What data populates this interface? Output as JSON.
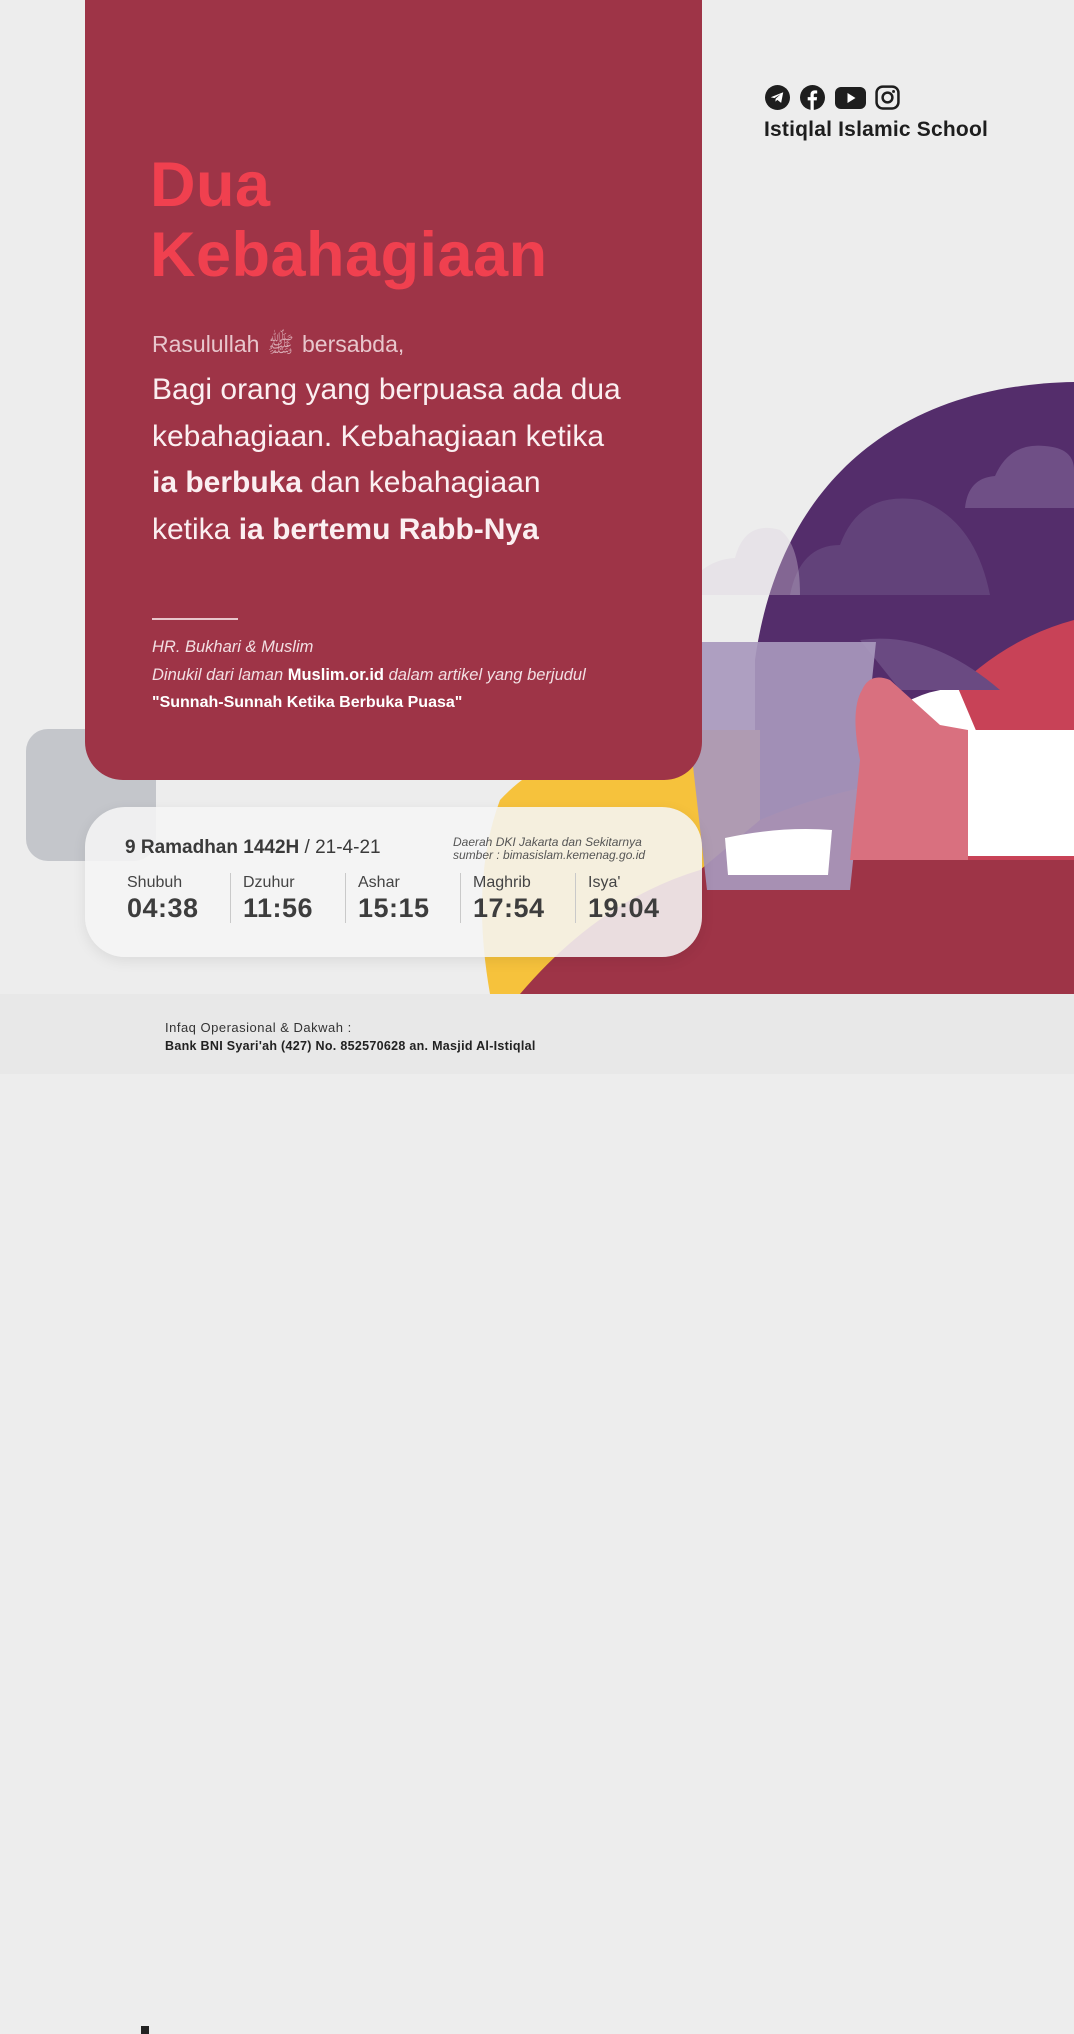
{
  "brand": {
    "name": "Istiqlal Islamic School",
    "social": [
      "telegram-icon",
      "facebook-icon",
      "youtube-icon",
      "instagram-icon"
    ]
  },
  "headline": {
    "line1": "Dua",
    "line2": "Kebahagiaan"
  },
  "lead": {
    "prefix": "Rasulullah",
    "honorific": "ﷺ",
    "suffix": "bersabda,"
  },
  "hadith": {
    "p1": "Bagi orang yang berpuasa ada dua kebahagiaan. Kebahagiaan ketika ",
    "b1": "ia berbuka",
    "p2": " dan kebahagiaan ketika ",
    "b2": "ia bertemu Rabb-Nya"
  },
  "source": {
    "narrator": "HR. Bukhari & Muslim",
    "cite_prefix": "Dinukil dari laman ",
    "site": "Muslim.or.id",
    "cite_suffix": " dalam artikel yang berjudul",
    "article": "\"Sunnah-Sunnah Ketika Berbuka Puasa\""
  },
  "schedule": {
    "hijri": "9 Ramadhan 1442H",
    "separator": " / ",
    "gregorian": "21-4-21",
    "region": "Daerah DKI Jakarta dan Sekitarnya",
    "reference": "sumber : bimasislam.kemenag.go.id",
    "prayers": [
      {
        "name": "Shubuh",
        "time": "04:38"
      },
      {
        "name": "Dzuhur",
        "time": "11:56"
      },
      {
        "name": "Ashar",
        "time": "15:15"
      },
      {
        "name": "Maghrib",
        "time": "17:54"
      },
      {
        "name": "Isya'",
        "time": "19:04"
      }
    ]
  },
  "footer": {
    "label": "Infaq Operasional & Dakwah :",
    "account": "Bank BNI Syari'ah (427) No. 852570628 an. Masjid Al-Istiqlal"
  },
  "colors": {
    "card": "#9e3447",
    "headline": "#f0404f",
    "purple": "#542d6b",
    "yellow": "#f6c23c"
  }
}
